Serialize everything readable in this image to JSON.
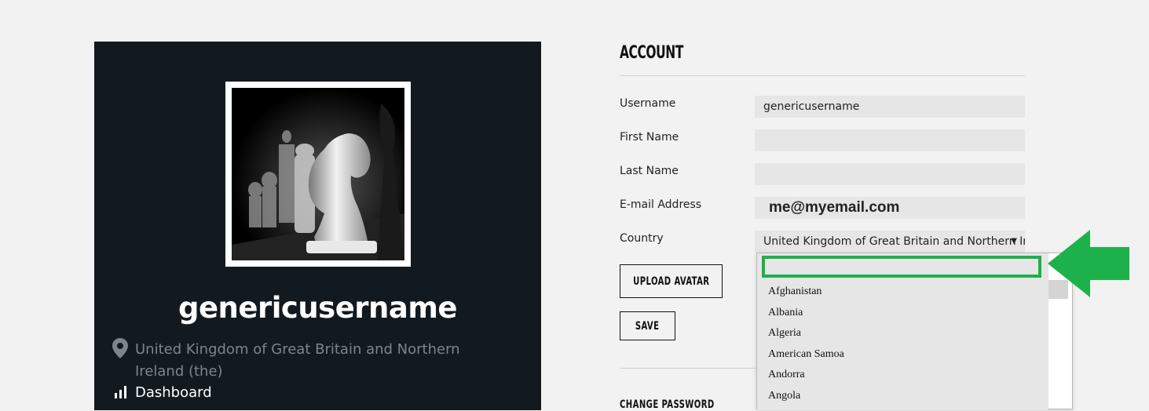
{
  "profile": {
    "username": "genericusername",
    "location": "United Kingdom of Great Britain and Northern Ireland (the)",
    "dashboard_label": "Dashboard"
  },
  "account": {
    "title": "ACCOUNT",
    "fields": {
      "username": {
        "label": "Username",
        "value": "genericusername"
      },
      "first_name": {
        "label": "First Name",
        "value": ""
      },
      "last_name": {
        "label": "Last Name",
        "value": ""
      },
      "email": {
        "label": "E-mail Address",
        "value": "me@myemail.com"
      },
      "country": {
        "label": "Country",
        "value": "United Kingdom of Great Britain and Northern Ireland (the)"
      }
    },
    "upload_avatar_label": "UPLOAD AVATAR",
    "save_label": "SAVE",
    "change_password_title": "CHANGE PASSWORD"
  },
  "country_dropdown": {
    "search_value": "",
    "options": [
      "Afghanistan",
      "Albania",
      "Algeria",
      "American Samoa",
      "Andorra",
      "Angola"
    ]
  },
  "colors": {
    "card_bg": "#121a20",
    "page_bg": "#f2f2f2",
    "input_bg": "#e6e6e6",
    "annotation_green": "#1db14b"
  }
}
